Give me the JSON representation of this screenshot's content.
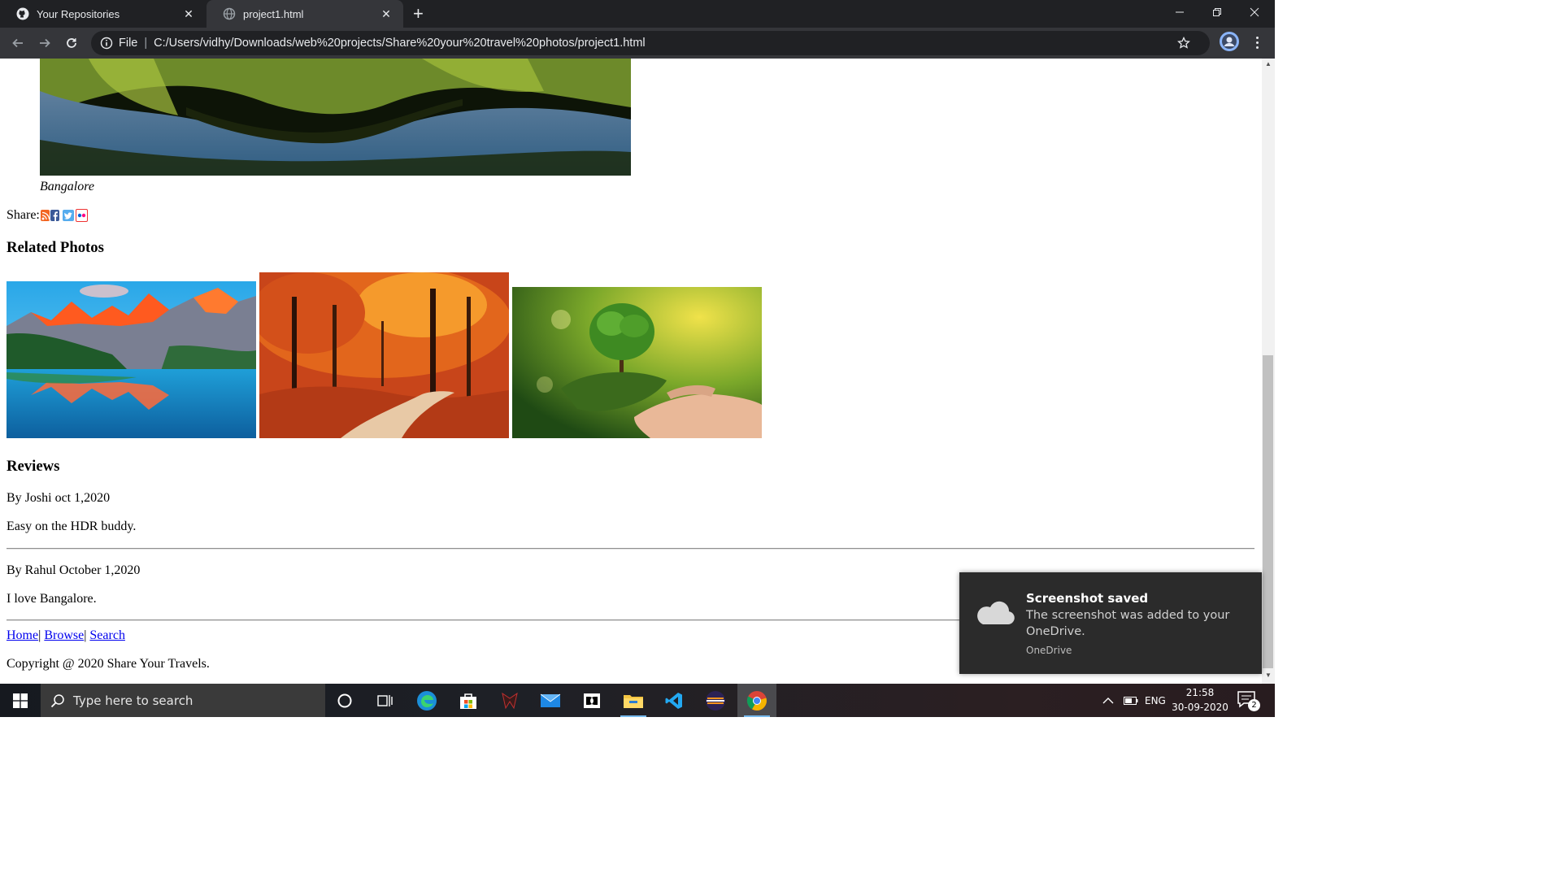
{
  "browser": {
    "tabs": [
      {
        "title": "Your Repositories",
        "active": false,
        "icon": "github-icon"
      },
      {
        "title": "project1.html",
        "active": true,
        "icon": "globe-icon"
      }
    ],
    "new_tab_label": "+",
    "omnibox": {
      "scheme": "File",
      "url": "C:/Users/vidhy/Downloads/web%20projects/Share%20your%20travel%20photos/project1.html"
    }
  },
  "page": {
    "caption": "Bangalore",
    "share_label": "Share:",
    "share_icons": [
      "rss-icon",
      "facebook-icon",
      "twitter-icon",
      "flickr-icon"
    ],
    "related_heading": "Related Photos",
    "related_photos": [
      {
        "name": "mountain-lake-photo"
      },
      {
        "name": "autumn-forest-photo"
      },
      {
        "name": "tree-in-hand-photo"
      }
    ],
    "reviews_heading": "Reviews",
    "reviews": [
      {
        "byline": "By Joshi oct 1,2020",
        "text": "Easy on the HDR buddy."
      },
      {
        "byline": "By Rahul October 1,2020",
        "text": "I love Bangalore."
      }
    ],
    "footer_links": [
      "Home",
      "Browse",
      "Search"
    ],
    "footer_separator": "|",
    "copyright": "Copyright @ 2020 Share Your Travels."
  },
  "toast": {
    "title": "Screenshot saved",
    "body": "The screenshot was added to your OneDrive.",
    "source": "OneDrive"
  },
  "taskbar": {
    "search_placeholder": "Type here to search",
    "language": "ENG",
    "time": "21:58",
    "date": "30-09-2020",
    "notification_count": "2",
    "apps": [
      "cortana-icon",
      "task-view-icon",
      "edge-icon",
      "store-icon",
      "predator-icon",
      "mail-icon",
      "dolby-icon",
      "file-explorer-icon",
      "vscode-icon",
      "eclipse-icon",
      "chrome-icon"
    ]
  }
}
